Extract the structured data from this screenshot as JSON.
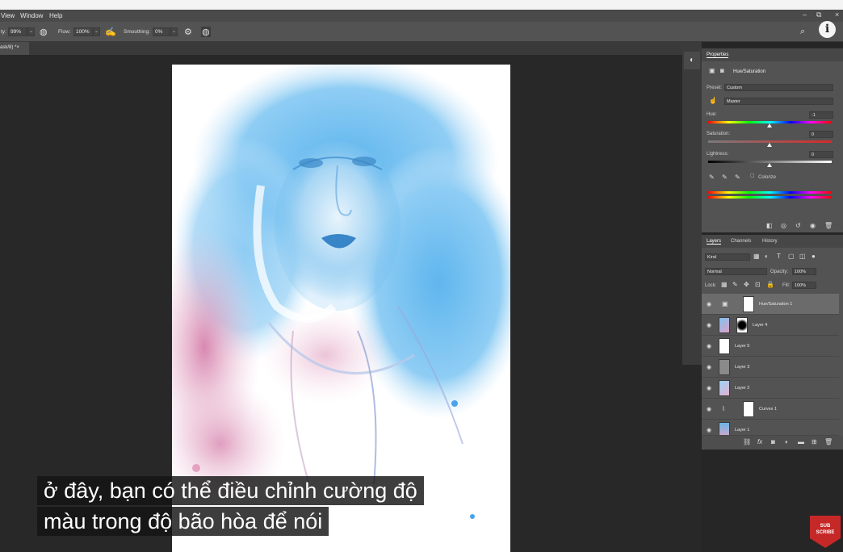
{
  "menu": {
    "items": [
      "View",
      "Window",
      "Help"
    ]
  },
  "window_controls": {
    "minimize": "–",
    "restore": "⧉",
    "close": "×"
  },
  "options_bar": {
    "opacity_label": "ty:",
    "opacity_value": "99%",
    "flow_label": "Flow:",
    "flow_value": "100%",
    "smoothing_label": "Smoothing:",
    "smoothing_value": "0%"
  },
  "document_tab": {
    "label": "ask/8) *",
    "close": "×"
  },
  "subtitles": {
    "line1": "ở đây, bạn có thể điều chỉnh cường độ",
    "line2": "màu trong  độ bão hòa để nói"
  },
  "properties": {
    "tab_label": "Properties",
    "adjustment_title": "Hue/Saturation",
    "preset_label": "Preset:",
    "preset_value": "Custom",
    "channel_value": "Master",
    "hue_label": "Hue:",
    "hue_value": "-1",
    "hue_level": -1,
    "saturation_label": "Saturation:",
    "saturation_value": "0",
    "lightness_label": "Lightness:",
    "lightness_value": "0",
    "colorize_label": "Colorize"
  },
  "layers_panel": {
    "tabs": [
      "Layers",
      "Channels",
      "History"
    ],
    "kind_label": "Kind",
    "blend_mode": "Normal",
    "opacity_label": "Opacity:",
    "opacity_value": "100%",
    "lock_label": "Lock:",
    "fill_label": "Fill:",
    "fill_value": "100%",
    "layers": [
      {
        "name": "Hue/Saturation 1",
        "selected": true
      },
      {
        "name": "Layer 4",
        "selected": false
      },
      {
        "name": "Layer 5",
        "selected": false
      },
      {
        "name": "Layer 3",
        "selected": false
      },
      {
        "name": "Layer 2",
        "selected": false
      },
      {
        "name": "Curves 1",
        "selected": false
      },
      {
        "name": "Layer 1",
        "selected": false
      }
    ]
  },
  "overlay": {
    "subscribe_line1": "SUB",
    "subscribe_line2": "SCRIBE",
    "info_glyph": "i"
  },
  "colors": {
    "workspace": "#282828",
    "panel": "#535353",
    "accent_blue": "#4aa3e8",
    "accent_pink": "#d97aa6"
  }
}
